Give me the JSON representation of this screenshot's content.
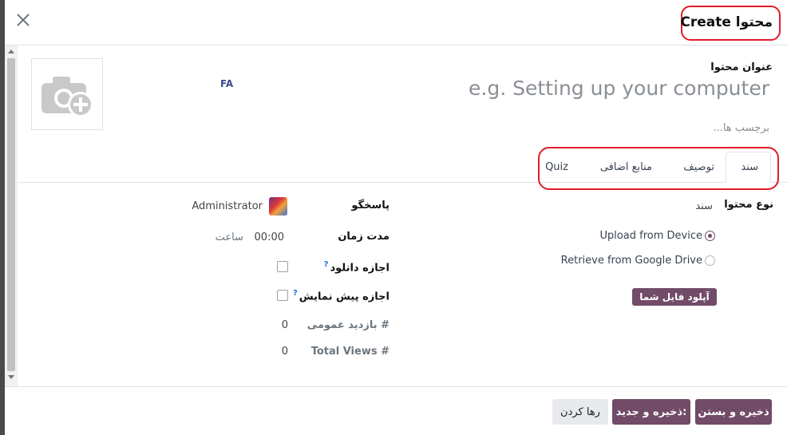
{
  "modal": {
    "title": "Create محتوا"
  },
  "form": {
    "content_title_label": "عنوان محتوا",
    "title_placeholder": "e.g. Setting up your computer",
    "tags_placeholder": "برچسب ها...",
    "lang_badge": "FA"
  },
  "tabs": [
    {
      "label": "سند",
      "active": true
    },
    {
      "label": "توصیف",
      "active": false
    },
    {
      "label": "منابع اضافی",
      "active": false
    },
    {
      "label": "Quiz",
      "active": false
    }
  ],
  "document": {
    "content_type_label": "نوع محتوا",
    "content_type_value": "سند",
    "sources": [
      {
        "label": "Upload from Device",
        "checked": true
      },
      {
        "label": "Retrieve from Google Drive",
        "checked": false
      }
    ],
    "upload_button": "آپلود فایل شما"
  },
  "details": {
    "responsible_label": "پاسخگو",
    "responsible_value": "Administrator",
    "duration_label": "مدت زمان",
    "duration_value": "00:00",
    "duration_unit": "ساعت",
    "allow_download_label": "اجازه دانلود",
    "allow_download_checked": false,
    "allow_preview_label": "اجازه پیش نمایش",
    "allow_preview_checked": false,
    "public_views_label": "# بازدید عمومی",
    "public_views_value": "0",
    "total_views_label": "Total Views #",
    "total_views_value": "0",
    "help_mark": "?"
  },
  "footer": {
    "save_close": "ذخیره و بستن",
    "save_new": "ذخیره و جدید:",
    "discard": "رها کردن"
  },
  "colors": {
    "primary": "#714b67",
    "annotation_red": "#e01c2a",
    "badge_blue": "#374a8c"
  }
}
